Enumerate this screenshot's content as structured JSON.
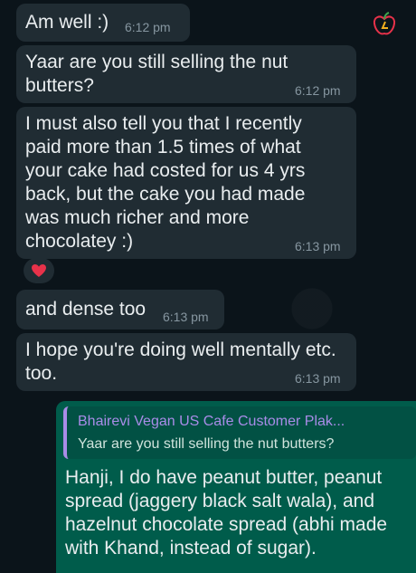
{
  "messages": [
    {
      "text": "Am well :)",
      "time": "6:12 pm"
    },
    {
      "text": "Yaar are you still selling the nut butters?",
      "time": "6:12 pm"
    },
    {
      "text": "I must also tell you that I recently paid more than 1.5 times of what your cake had costed for us 4 yrs back, but the cake you had made was much richer and more chocolatey :)",
      "time": "6:13 pm"
    },
    {
      "text": "and dense too",
      "time": "6:13 pm"
    },
    {
      "text": "I hope you're doing well mentally etc. too.",
      "time": "6:13 pm"
    }
  ],
  "reaction": {
    "icon": "red-heart-icon",
    "color": "#e8324a"
  },
  "reply": {
    "quoted_author": "Bhairevi Vegan US Cafe Customer Plak...",
    "quoted_text": "Yaar are you still selling the nut butters?",
    "text": "Hanji, I do have peanut butter, peanut spread (jaggery black salt wala), and hazelnut chocolate spread (abhi made with Khand, instead of sugar)."
  },
  "colors": {
    "background": "#0b141a",
    "incoming_bubble": "#202c33",
    "outgoing_bubble": "#005c4b",
    "quote_accent": "#a98ce8",
    "timestamp": "#8696a0"
  }
}
